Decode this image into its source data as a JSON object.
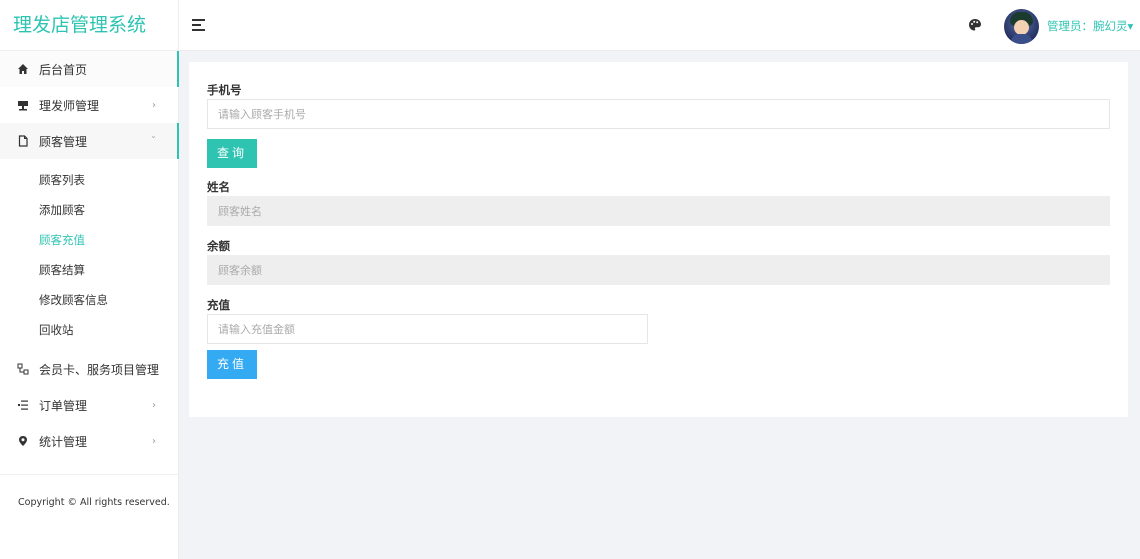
{
  "brand": "理发店管理系统",
  "sidebar": {
    "items": [
      {
        "label": "后台首页",
        "icon": "home-icon"
      },
      {
        "label": "理发师管理",
        "icon": "barber-icon"
      },
      {
        "label": "顾客管理",
        "icon": "document-icon"
      },
      {
        "label": "会员卡、服务项目管理",
        "icon": "grid-icon"
      },
      {
        "label": "订单管理",
        "icon": "list-icon"
      },
      {
        "label": "统计管理",
        "icon": "location-icon"
      }
    ],
    "submenu": [
      "顾客列表",
      "添加顾客",
      "顾客充值",
      "顾客结算",
      "修改顾客信息",
      "回收站"
    ],
    "copyright": "Copyright © All rights reserved."
  },
  "header": {
    "user_label": "管理员：腕幻灵"
  },
  "form": {
    "phone_label": "手机号",
    "phone_placeholder": "请输入顾客手机号",
    "query_button": "查询",
    "name_label": "姓名",
    "name_placeholder": "顾客姓名",
    "balance_label": "余额",
    "balance_placeholder": "顾客余额",
    "recharge_label": "充值",
    "recharge_placeholder": "请输入充值金额",
    "recharge_button": "充值"
  },
  "colors": {
    "accent": "#2fc4b2",
    "button_blue": "#33aaf2",
    "background": "#f2f3f7"
  }
}
